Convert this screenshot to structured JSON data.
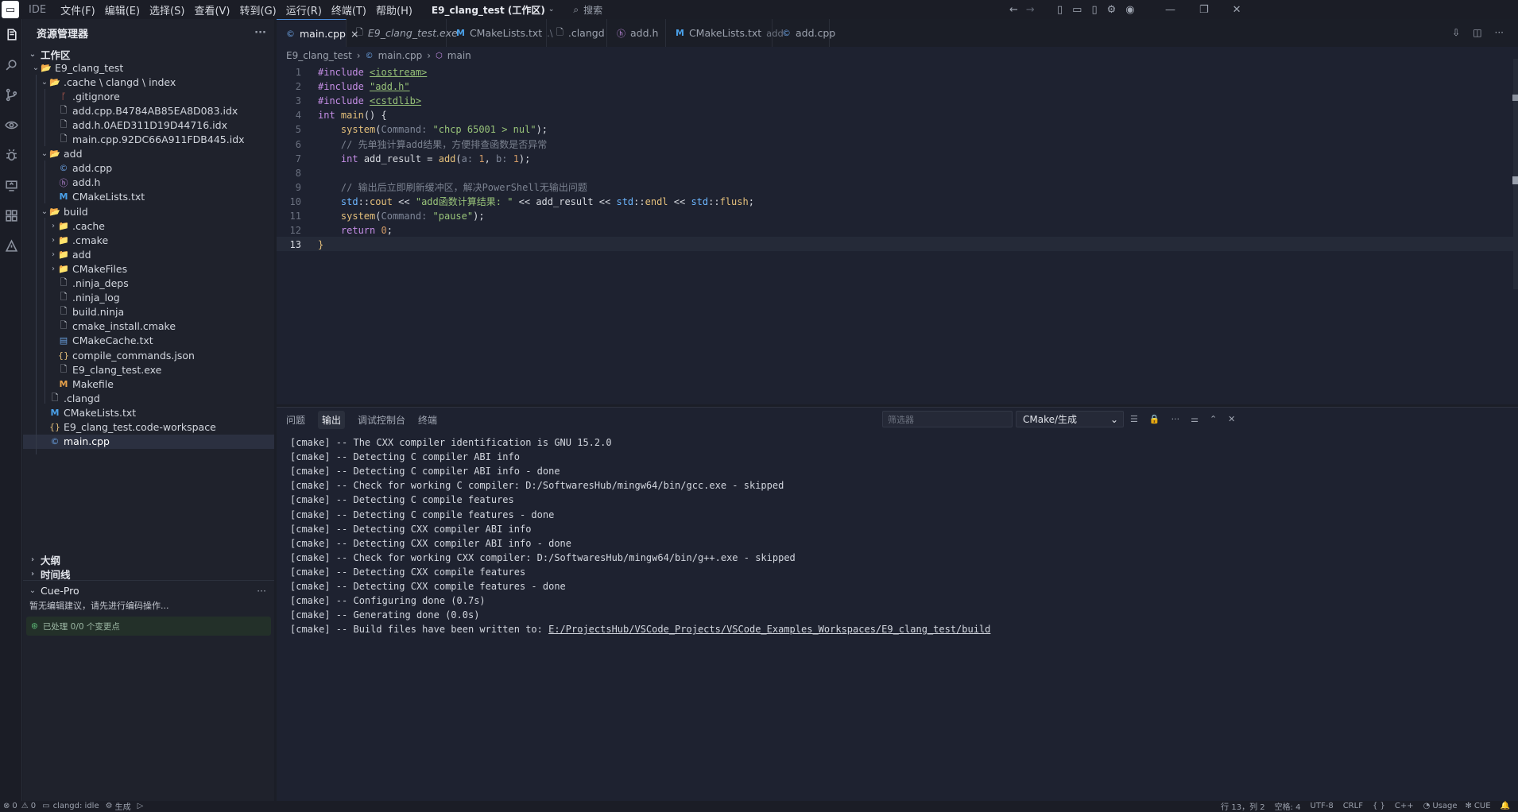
{
  "titlebar": {
    "logo": "IDE",
    "app": "IDE",
    "menus": [
      "文件(F)",
      "编辑(E)",
      "选择(S)",
      "查看(V)",
      "转到(G)",
      "运行(R)",
      "终端(T)",
      "帮助(H)"
    ],
    "workspace": "E9_clang_test (工作区)",
    "search": "搜索"
  },
  "sidebar": {
    "title": "资源管理器",
    "workspace_label": "工作区",
    "tree": [
      {
        "label": "E9_clang_test",
        "depth": 0,
        "type": "folder-open",
        "chev": "⌄"
      },
      {
        "label": ".cache \\ clangd \\ index",
        "depth": 1,
        "type": "folder-open",
        "chev": "⌄"
      },
      {
        "label": ".gitignore",
        "depth": 2,
        "type": "git"
      },
      {
        "label": "add.cpp.B4784AB85EA8D083.idx",
        "depth": 2,
        "type": "file"
      },
      {
        "label": "add.h.0AED311D19D44716.idx",
        "depth": 2,
        "type": "file"
      },
      {
        "label": "main.cpp.92DC66A911FDB445.idx",
        "depth": 2,
        "type": "file"
      },
      {
        "label": "add",
        "depth": 1,
        "type": "folder-open",
        "chev": "⌄"
      },
      {
        "label": "add.cpp",
        "depth": 2,
        "type": "cpp"
      },
      {
        "label": "add.h",
        "depth": 2,
        "type": "h"
      },
      {
        "label": "CMakeLists.txt",
        "depth": 2,
        "type": "cmake"
      },
      {
        "label": "build",
        "depth": 1,
        "type": "folder-open",
        "chev": "⌄"
      },
      {
        "label": ".cache",
        "depth": 2,
        "type": "folder",
        "chev": "›"
      },
      {
        "label": ".cmake",
        "depth": 2,
        "type": "folder",
        "chev": "›"
      },
      {
        "label": "add",
        "depth": 2,
        "type": "folder",
        "chev": "›"
      },
      {
        "label": "CMakeFiles",
        "depth": 2,
        "type": "folder",
        "chev": "›"
      },
      {
        "label": ".ninja_deps",
        "depth": 2,
        "type": "file"
      },
      {
        "label": ".ninja_log",
        "depth": 2,
        "type": "file"
      },
      {
        "label": "build.ninja",
        "depth": 2,
        "type": "file"
      },
      {
        "label": "cmake_install.cmake",
        "depth": 2,
        "type": "file"
      },
      {
        "label": "CMakeCache.txt",
        "depth": 2,
        "type": "txt"
      },
      {
        "label": "compile_commands.json",
        "depth": 2,
        "type": "json"
      },
      {
        "label": "E9_clang_test.exe",
        "depth": 2,
        "type": "file"
      },
      {
        "label": "Makefile",
        "depth": 2,
        "type": "make"
      },
      {
        "label": ".clangd",
        "depth": 1,
        "type": "file"
      },
      {
        "label": "CMakeLists.txt",
        "depth": 1,
        "type": "cmake"
      },
      {
        "label": "E9_clang_test.code-workspace",
        "depth": 1,
        "type": "json"
      },
      {
        "label": "main.cpp",
        "depth": 1,
        "type": "cpp",
        "selected": true
      }
    ],
    "outline": "大纲",
    "timeline": "时间线",
    "cue": {
      "title": "Cue-Pro",
      "message": "暂无编辑建议，请先进行编码操作...",
      "processed": "已处理 0/0 个变更点"
    }
  },
  "tabs": [
    {
      "label": "main.cpp",
      "icon": "cpp",
      "active": true,
      "close": "×"
    },
    {
      "label": "E9_clang_test.exe",
      "icon": "file",
      "italic": true
    },
    {
      "label": "CMakeLists.txt",
      "icon": "cmake",
      "sub": ".\\"
    },
    {
      "label": ".clangd",
      "icon": "file"
    },
    {
      "label": "add.h",
      "icon": "h"
    },
    {
      "label": "CMakeLists.txt",
      "icon": "cmake",
      "sub": "add"
    },
    {
      "label": "add.cpp",
      "icon": "cpp"
    }
  ],
  "breadcrumb": [
    "E9_clang_test",
    "main.cpp",
    "main"
  ],
  "code": [
    [
      [
        "pp",
        "#include "
      ],
      [
        "inc",
        "<iostream>"
      ]
    ],
    [
      [
        "pp",
        "#include "
      ],
      [
        "inc",
        "\"add.h\""
      ]
    ],
    [
      [
        "pp",
        "#include "
      ],
      [
        "inc",
        "<cstdlib>"
      ]
    ],
    [
      [
        "kw",
        "int "
      ],
      [
        "fn",
        "main"
      ],
      [
        "id",
        "() {"
      ]
    ],
    [
      [
        "id",
        "    "
      ],
      [
        "fn",
        "system"
      ],
      [
        "id",
        "("
      ],
      [
        "hint",
        "Command:"
      ],
      [
        "str",
        " \"chcp 65001 > nul\""
      ],
      [
        "id",
        ");"
      ]
    ],
    [
      [
        "cm",
        "    // 先单独计算add结果，方便排查函数是否异常"
      ]
    ],
    [
      [
        "id",
        "    "
      ],
      [
        "kw",
        "int "
      ],
      [
        "id",
        "add_result = "
      ],
      [
        "fn",
        "add"
      ],
      [
        "id",
        "("
      ],
      [
        "hint",
        "a:"
      ],
      [
        "num",
        " 1"
      ],
      [
        "id",
        ", "
      ],
      [
        "hint",
        "b:"
      ],
      [
        "num",
        " 1"
      ],
      [
        "id",
        ");"
      ]
    ],
    [
      [
        "id",
        ""
      ]
    ],
    [
      [
        "cm",
        "    // 输出后立即刷新缓冲区，解决PowerShell无输出问题"
      ]
    ],
    [
      [
        "id",
        "    "
      ],
      [
        "ns",
        "std"
      ],
      [
        "id",
        "::"
      ],
      [
        "fn",
        "cout"
      ],
      [
        "id",
        " << "
      ],
      [
        "str",
        "\"add函数计算结果: \""
      ],
      [
        "id",
        " << add_result << "
      ],
      [
        "ns",
        "std"
      ],
      [
        "id",
        "::"
      ],
      [
        "fn",
        "endl"
      ],
      [
        "id",
        " << "
      ],
      [
        "ns",
        "std"
      ],
      [
        "id",
        "::"
      ],
      [
        "fn",
        "flush"
      ],
      [
        "id",
        ";"
      ]
    ],
    [
      [
        "id",
        "    "
      ],
      [
        "fn",
        "system"
      ],
      [
        "id",
        "("
      ],
      [
        "hint",
        "Command:"
      ],
      [
        "str",
        " \"pause\""
      ],
      [
        "id",
        ");"
      ]
    ],
    [
      [
        "id",
        "    "
      ],
      [
        "kw",
        "return "
      ],
      [
        "num",
        "0"
      ],
      [
        "id",
        ";"
      ]
    ],
    [
      [
        "fn",
        "}"
      ]
    ]
  ],
  "panel": {
    "tabs": [
      "问题",
      "输出",
      "调试控制台",
      "终端"
    ],
    "active": 1,
    "filter_placeholder": "筛选器",
    "channel": "CMake/生成",
    "output": [
      "[cmake] -- The CXX compiler identification is GNU 15.2.0",
      "[cmake] -- Detecting C compiler ABI info",
      "[cmake] -- Detecting C compiler ABI info - done",
      "[cmake] -- Check for working C compiler: D:/SoftwaresHub/mingw64/bin/gcc.exe - skipped",
      "[cmake] -- Detecting C compile features",
      "[cmake] -- Detecting C compile features - done",
      "[cmake] -- Detecting CXX compiler ABI info",
      "[cmake] -- Detecting CXX compiler ABI info - done",
      "[cmake] -- Check for working CXX compiler: D:/SoftwaresHub/mingw64/bin/g++.exe - skipped",
      "[cmake] -- Detecting CXX compile features",
      "[cmake] -- Detecting CXX compile features - done",
      "[cmake] -- Configuring done (0.7s)",
      "[cmake] -- Generating done (0.0s)"
    ],
    "last_prefix": "[cmake] -- Build files have been written to: ",
    "last_link": "E:/ProjectsHub/VSCode_Projects/VSCode_Examples_Workspaces/E9_clang_test/build"
  },
  "status": {
    "errors": "0",
    "warnings": "0",
    "clangd": "clangd: idle",
    "build": "生成",
    "position": "行 13，列 2",
    "indent": "空格: 4",
    "encoding": "UTF-8",
    "eol": "CRLF",
    "braces": "{ }",
    "lang": "C++",
    "usage": "Usage",
    "cue": "CUE"
  },
  "colors": {
    "accent": "#4a8ad8",
    "bg": "#1e2230",
    "sidebar": "#1f222c"
  }
}
